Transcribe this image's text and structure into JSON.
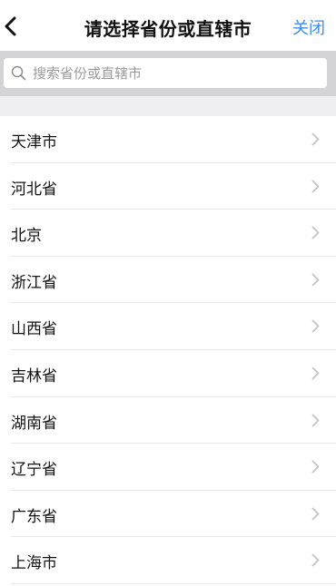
{
  "header": {
    "title": "请选择省份或直辖市",
    "close_label": "关闭",
    "back_icon": "chevron-left-icon"
  },
  "search": {
    "placeholder": "搜索省份或直辖市",
    "value": "",
    "icon": "search-icon"
  },
  "provinces": [
    {
      "label": "天津市"
    },
    {
      "label": "河北省"
    },
    {
      "label": "北京"
    },
    {
      "label": "浙江省"
    },
    {
      "label": "山西省"
    },
    {
      "label": "吉林省"
    },
    {
      "label": "湖南省"
    },
    {
      "label": "辽宁省"
    },
    {
      "label": "广东省"
    },
    {
      "label": "上海市"
    }
  ],
  "colors": {
    "accent": "#3c8cf0",
    "search_bar_bg": "#d4d4d6",
    "section_gap_bg": "#efeff1",
    "chevron": "#c4c4c4"
  }
}
